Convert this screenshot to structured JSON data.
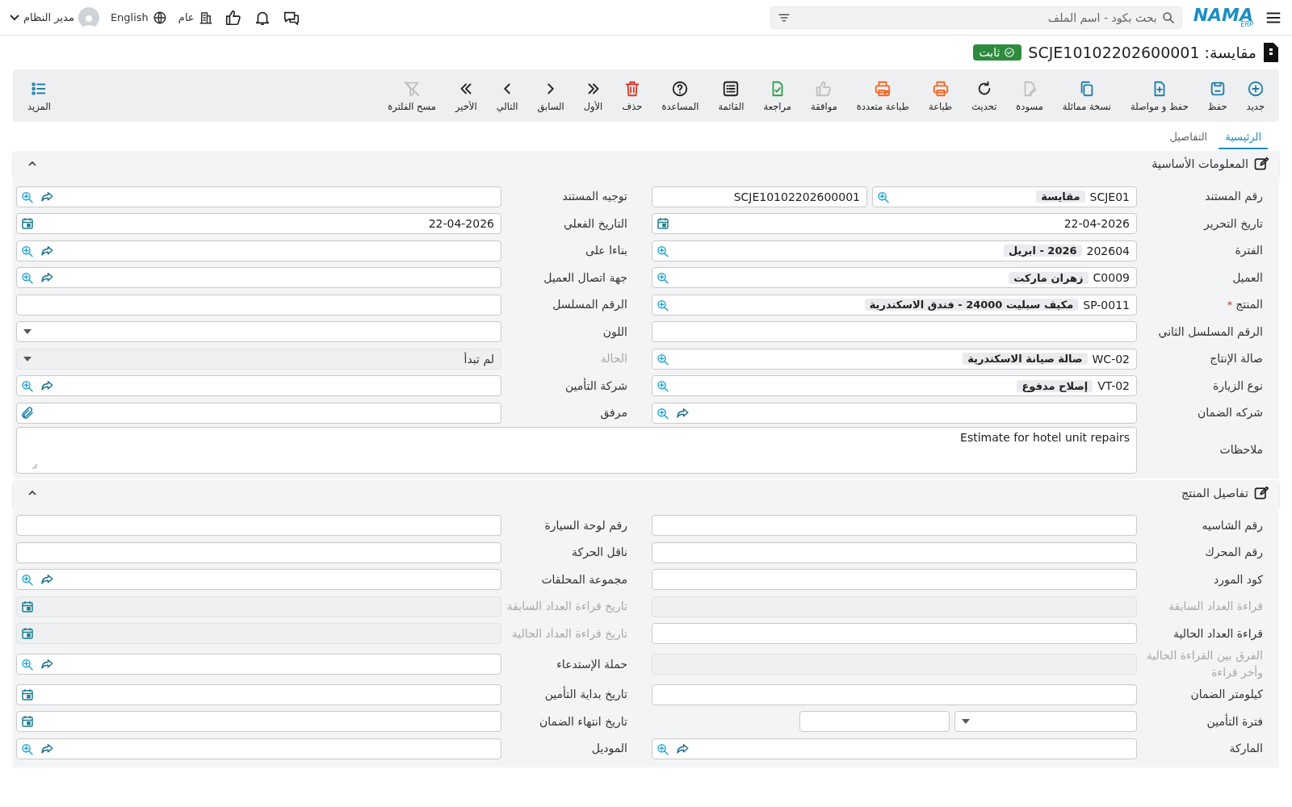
{
  "header": {
    "logo": "NAMA",
    "logo_sub": "ERP",
    "search": {
      "placeholder": "بحث بكود - اسم الملف"
    },
    "branch": "عام",
    "language": "English",
    "user": "مدير النظام"
  },
  "title": {
    "text": "مقايسة: SCJE10102202600001",
    "status": "ثابت"
  },
  "toolbar": [
    {
      "label": "جديد",
      "color": "#1f7fa8",
      "disabled": false
    },
    {
      "label": "حفظ",
      "color": "#1f7fa8",
      "disabled": false
    },
    {
      "label": "حفظ و مواصلة",
      "color": "#1f7fa8",
      "disabled": false
    },
    {
      "label": "نسخة مماثلة",
      "color": "#1f7fa8",
      "disabled": false
    },
    {
      "label": "مسودة",
      "disabled": true
    },
    {
      "label": "تحديث",
      "color": "#222222",
      "disabled": false
    },
    {
      "label": "طباعة",
      "color": "#f26522",
      "disabled": false
    },
    {
      "label": "طباعة متعددة",
      "color": "#f26522",
      "disabled": false
    },
    {
      "label": "موافقة",
      "disabled": true
    },
    {
      "label": "مراجعة",
      "color": "#2e9e4f",
      "disabled": false
    },
    {
      "label": "القائمة",
      "color": "#222222",
      "disabled": false
    },
    {
      "label": "المساعدة",
      "color": "#222222",
      "disabled": false
    },
    {
      "label": "حذف",
      "color": "#d23a2a",
      "disabled": false
    },
    {
      "label": "الأول",
      "color": "#222222",
      "disabled": false
    },
    {
      "label": "السابق",
      "color": "#222222",
      "disabled": false
    },
    {
      "label": "التالي",
      "color": "#222222",
      "disabled": false
    },
    {
      "label": "الأخير",
      "color": "#222222",
      "disabled": false
    },
    {
      "label": "مسح الفلترة",
      "disabled": true
    }
  ],
  "more": {
    "label": "المزيد"
  },
  "tabs": [
    {
      "label": "الرئيسية",
      "selected": true
    },
    {
      "label": "التفاصيل",
      "selected": false
    }
  ],
  "sections": [
    {
      "title": "المعلومات الأساسية",
      "expanded": true,
      "fields": [
        {
          "label": "رقم المستند",
          "kind": "doc-number",
          "value": "SCJE01",
          "name": "مقايسة",
          "value2": "SCJE10102202600001",
          "required": false,
          "disabled": false
        },
        {
          "label": "توجيه المستند",
          "kind": "lookup",
          "link": true,
          "required": false,
          "disabled": false
        },
        {
          "label": "تاريخ التحرير",
          "kind": "date",
          "value": "22-04-2026",
          "required": false,
          "disabled": false
        },
        {
          "label": "التاريخ الفعلي",
          "kind": "date",
          "value": "22-04-2026",
          "required": false,
          "disabled": false
        },
        {
          "label": "الفترة",
          "kind": "lookup",
          "value": "202604",
          "name": "2026 - ابريل",
          "link": false,
          "required": false,
          "disabled": false
        },
        {
          "label": "بناءا على",
          "kind": "lookup",
          "link": true,
          "required": false,
          "disabled": false
        },
        {
          "label": "العميل",
          "kind": "lookup",
          "value": "C0009",
          "name": "زهران ماركت",
          "link": false,
          "required": false,
          "disabled": false
        },
        {
          "label": "جهة اتصال العميل",
          "kind": "lookup",
          "link": true,
          "required": false,
          "disabled": false
        },
        {
          "label": "المنتج",
          "kind": "lookup",
          "value": "SP-0011",
          "name": "مكيف سبليت 24000 - فندق الاسكندرية",
          "link": false,
          "required": true,
          "mark": "*",
          "disabled": false
        },
        {
          "label": "الرقم المسلسل",
          "kind": "text",
          "required": false,
          "disabled": false
        },
        {
          "label": "الرقم المسلسل الثاني",
          "kind": "text",
          "required": false,
          "disabled": false
        },
        {
          "label": "اللون",
          "kind": "select",
          "required": false,
          "disabled": false
        },
        {
          "label": "صالة الإنتاج",
          "kind": "lookup",
          "value": "WC-02",
          "name": "صالة صيانة الاسكندرية",
          "link": false,
          "required": false,
          "disabled": false
        },
        {
          "label": "الحالة",
          "kind": "select",
          "value": "لم تبدأ",
          "required": false,
          "disabled": true
        },
        {
          "label": "نوع الزيارة",
          "kind": "lookup",
          "value": "VT-02",
          "name": "إصلاح مدفوع",
          "link": false,
          "required": false,
          "disabled": false
        },
        {
          "label": "شركة التأمين",
          "kind": "lookup",
          "link": true,
          "required": false,
          "disabled": false
        },
        {
          "label": "شركه الضمان",
          "kind": "lookup",
          "link": true,
          "required": false,
          "disabled": false
        },
        {
          "label": "مرفق",
          "kind": "attachment",
          "required": false,
          "disabled": false
        },
        {
          "label": "ملاحظات",
          "kind": "textarea",
          "value": "Estimate for hotel unit repairs",
          "required": false,
          "disabled": false
        }
      ]
    },
    {
      "title": "تفاصيل المنتج",
      "expanded": true,
      "fields": [
        {
          "label": "رقم الشاسيه",
          "kind": "text",
          "required": false,
          "disabled": false
        },
        {
          "label": "رقم لوحة السيارة",
          "kind": "text",
          "required": false,
          "disabled": false
        },
        {
          "label": "رقم المحرك",
          "kind": "text",
          "required": false,
          "disabled": false
        },
        {
          "label": "ناقل الحركة",
          "kind": "text",
          "required": false,
          "disabled": false
        },
        {
          "label": "كود المورد",
          "kind": "text",
          "required": false,
          "disabled": false
        },
        {
          "label": "مجموعة المحلقات",
          "kind": "lookup",
          "link": true,
          "required": false,
          "disabled": false
        },
        {
          "label": "قراءة العداد السابقة",
          "kind": "text",
          "required": false,
          "disabled": true
        },
        {
          "label": "تاريخ قراءة العداد السابقة",
          "kind": "date",
          "required": false,
          "disabled": true
        },
        {
          "label": "قراءة العداد الحالية",
          "kind": "text",
          "required": false,
          "disabled": false
        },
        {
          "label": "تاريخ قراءة العداد الحالية",
          "kind": "date",
          "required": false,
          "disabled": true
        },
        {
          "label": "الفرق بين القراءة الحالية وأخر قراءة",
          "kind": "text",
          "required": false,
          "disabled": true
        },
        {
          "label": "حملة الإستدعاء",
          "kind": "lookup",
          "link": true,
          "required": false,
          "disabled": false
        },
        {
          "label": "كيلومتر الضمان",
          "kind": "text",
          "required": false,
          "disabled": false
        },
        {
          "label": "تاريخ بداية التأمين",
          "kind": "date",
          "required": false,
          "disabled": false
        },
        {
          "label": "فترة التأمين",
          "kind": "select-pair",
          "required": false,
          "disabled": false
        },
        {
          "label": "تاريخ انتهاء الضمان",
          "kind": "date",
          "required": false,
          "disabled": false
        },
        {
          "label": "الماركة",
          "kind": "lookup",
          "link": true,
          "required": false,
          "disabled": false
        },
        {
          "label": "الموديل",
          "kind": "lookup",
          "link": true,
          "required": false,
          "disabled": false
        }
      ]
    }
  ]
}
